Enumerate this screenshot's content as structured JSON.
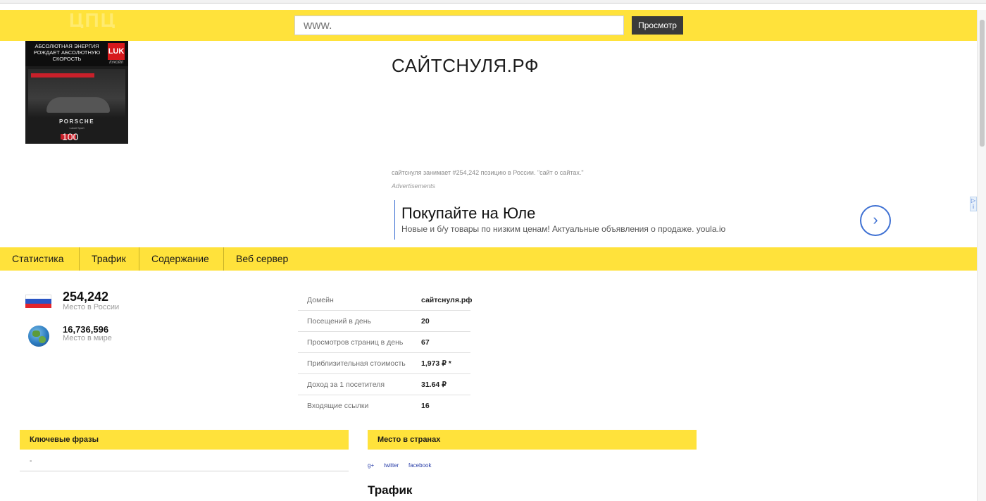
{
  "header": {
    "logo_text": "ЦПЦ",
    "url_value": "www.",
    "view_button": "Просмотр"
  },
  "ad_banner": {
    "tagline": "АБСОЛЮТНАЯ ЭНЕРГИЯ РОЖДАЕТ АБСОЛЮТНУЮ СКОРОСТЬ",
    "logo": "LUK",
    "logo_sub": "ЛУКОЙЛ",
    "brand": "PORSCHE",
    "brand_sub": "Lukoil Sport",
    "number": "100"
  },
  "site": {
    "title": "САЙТСНУЛЯ.РФ",
    "rank_note": "сайтснуля занимает #254,242 позицию в России. \"сайт о сайтах.\"",
    "ads_label": "Advertisements"
  },
  "ad": {
    "headline": "Покупайте на Юле",
    "description": "Новые и б/у товары по низким ценам! Актуальные объявления о продаже. youla.io",
    "arrow": "›",
    "choice": "▷ i"
  },
  "nav": {
    "items": [
      "Статистика",
      "Трафик",
      "Содержание",
      "Веб сервер"
    ]
  },
  "ranks": {
    "russia_value": "254,242",
    "russia_label": "Место в России",
    "world_value": "16,736,596",
    "world_label": "Место в мире"
  },
  "info": [
    {
      "key": "Домейн",
      "value": "сайтснуля.рф"
    },
    {
      "key": "Посещений в день",
      "value": "20"
    },
    {
      "key": "Просмотров страниц в день",
      "value": "67"
    },
    {
      "key": "Приблизительная стоимость",
      "value": "1,973 ₽ *"
    },
    {
      "key": "Доход за 1 посетителя",
      "value": "31.64 ₽"
    },
    {
      "key": "Входящие ссылки",
      "value": "16"
    }
  ],
  "panels": {
    "keywords_title": "Ключевые фразы",
    "keywords_empty": "-",
    "countries_title": "Место в странах"
  },
  "social": [
    "g+",
    "twitter",
    "facebook"
  ],
  "traffic_title": "Трафик"
}
